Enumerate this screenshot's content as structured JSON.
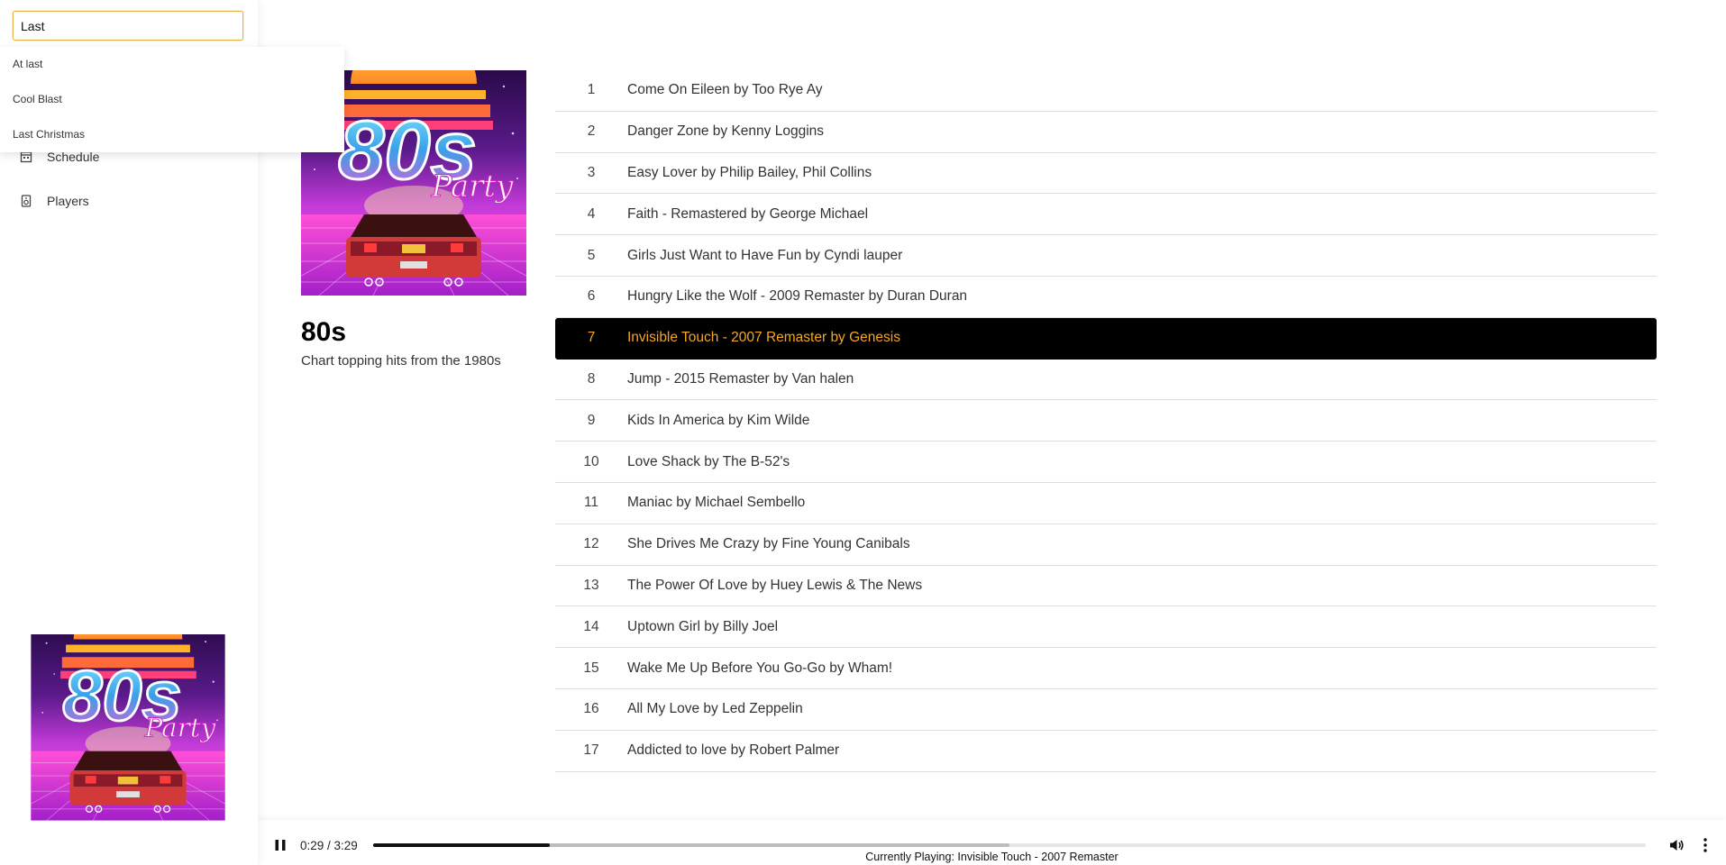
{
  "search": {
    "value": "Last"
  },
  "suggestions": [
    {
      "label": "At last"
    },
    {
      "label": "Cool Blast"
    },
    {
      "label": "Last Christmas"
    }
  ],
  "nav": {
    "items": [
      {
        "label": "Schedule",
        "icon": "calendar-icon"
      },
      {
        "label": "Players",
        "icon": "speaker-icon"
      }
    ]
  },
  "album_art": {
    "text_line1": "80s",
    "text_line2": "Party",
    "plate": "80s"
  },
  "playlist": {
    "title": "80s",
    "description": "Chart topping hits from the 1980s"
  },
  "tracks": [
    {
      "num": "1",
      "title": "Come On Eileen by Too Rye Ay"
    },
    {
      "num": "2",
      "title": "Danger Zone by Kenny Loggins"
    },
    {
      "num": "3",
      "title": "Easy Lover by Philip Bailey, Phil Collins"
    },
    {
      "num": "4",
      "title": "Faith - Remastered by George Michael"
    },
    {
      "num": "5",
      "title": "Girls Just Want to Have Fun by Cyndi lauper"
    },
    {
      "num": "6",
      "title": "Hungry Like the Wolf - 2009 Remaster by Duran Duran"
    },
    {
      "num": "7",
      "title": "Invisible Touch - 2007 Remaster by Genesis",
      "active": true
    },
    {
      "num": "8",
      "title": "Jump - 2015 Remaster by Van halen"
    },
    {
      "num": "9",
      "title": "Kids In America by Kim Wilde"
    },
    {
      "num": "10",
      "title": "Love Shack by The B-52's"
    },
    {
      "num": "11",
      "title": "Maniac by Michael Sembello"
    },
    {
      "num": "12",
      "title": "She Drives Me Crazy by Fine Young Canibals"
    },
    {
      "num": "13",
      "title": "The Power Of Love by Huey Lewis & The News"
    },
    {
      "num": "14",
      "title": "Uptown Girl by Billy Joel"
    },
    {
      "num": "15",
      "title": "Wake Me Up Before You Go-Go by Wham!"
    },
    {
      "num": "16",
      "title": "All My Love by Led Zeppelin"
    },
    {
      "num": "17",
      "title": "Addicted to love by Robert Palmer"
    }
  ],
  "player": {
    "time": "0:29 / 3:29",
    "progress_fraction": 0.139,
    "buffered_fraction": 0.5,
    "now_playing": "Currently Playing: Invisible Touch - 2007 Remaster",
    "pause_icon": "pause-icon",
    "volume_icon": "volume-icon",
    "menu_icon": "more-vertical-icon"
  },
  "colors": {
    "accent": "#f5a623",
    "active_row_bg": "#000000",
    "search_border": "#e8b44c"
  }
}
